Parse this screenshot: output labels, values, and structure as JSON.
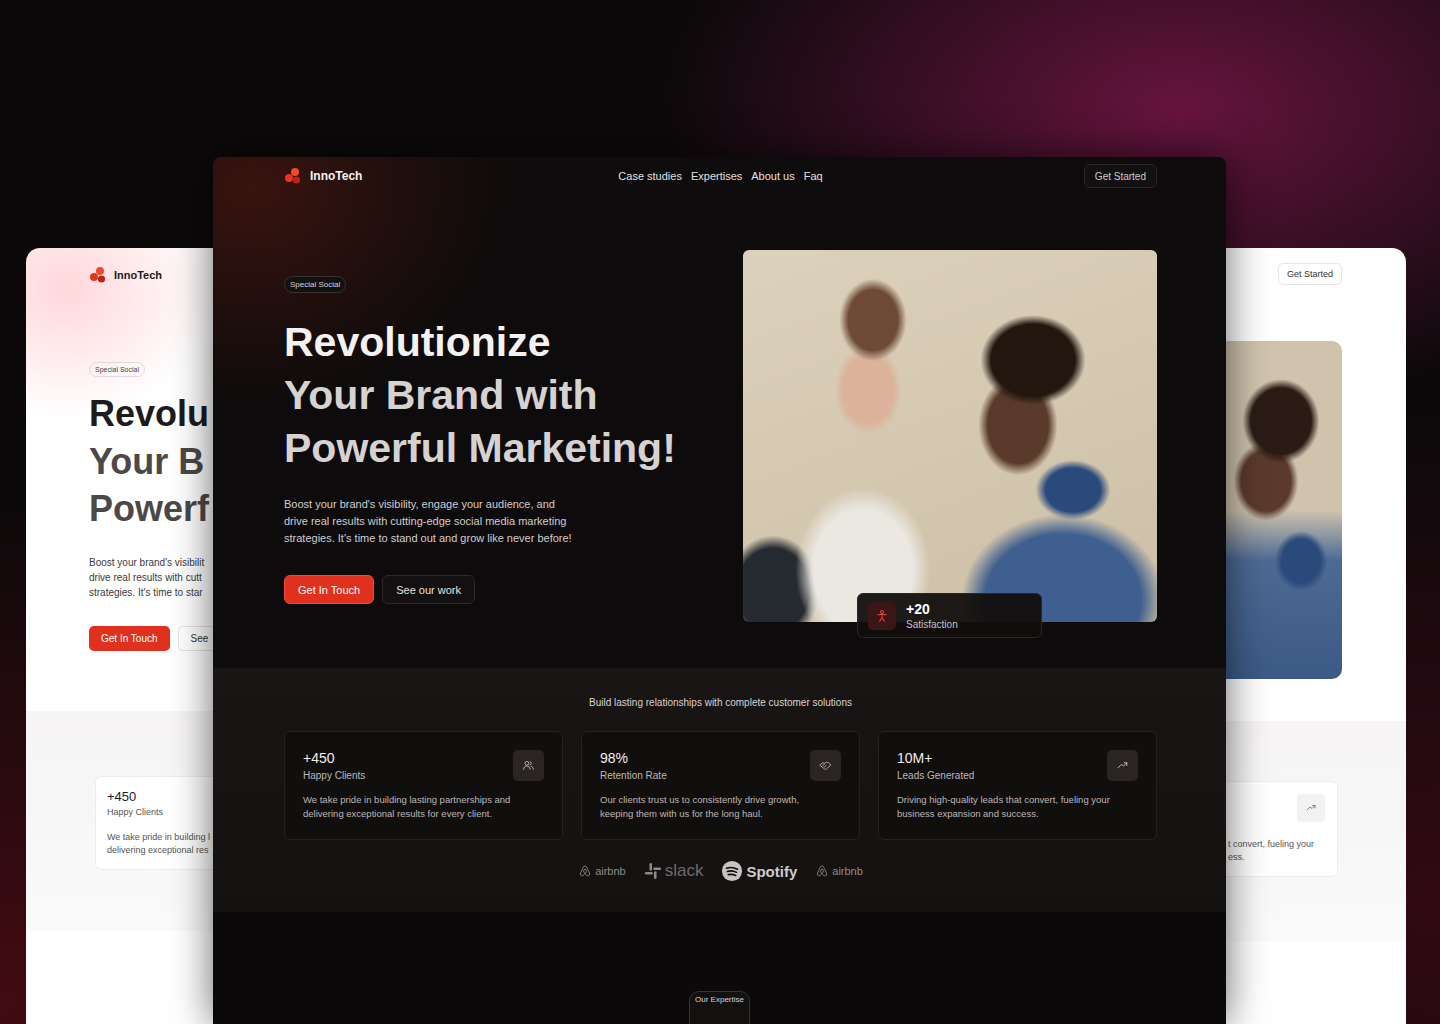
{
  "main": {
    "brand": "InnoTech",
    "nav": [
      {
        "label": "Case studies"
      },
      {
        "label": "Expertises"
      },
      {
        "label": "About us"
      },
      {
        "label": "Faq"
      }
    ],
    "cta": "Get Started",
    "badge": "Special Social",
    "headline": [
      "Revolutionize",
      "Your Brand with",
      "Powerful Marketing!"
    ],
    "body": [
      "Boost your brand's visibility, engage your audience, and",
      "drive real results with cutting-edge social media marketing",
      "strategies. It's time to stand out and grow like never before!"
    ],
    "primary_button": "Get In Touch",
    "secondary_button": "See our work",
    "photo_stat": {
      "value": "+20",
      "label": "Satisfaction"
    },
    "stats_title": "Build lasting relationships with complete customer solutions",
    "stats": [
      {
        "value": "+450",
        "label": "Happy Clients",
        "text": [
          "We take pride in building lasting partnerships and",
          "delivering exceptional results for every client."
        ]
      },
      {
        "value": "98%",
        "label": "Retention Rate",
        "text": [
          "Our clients trust us to consistently drive growth,",
          "keeping them with us for the long haul."
        ]
      },
      {
        "value": "10M+",
        "label": "Leads Generated",
        "text": [
          "Driving high-quality leads that convert, fueling your",
          "business expansion and success."
        ]
      }
    ],
    "partners": [
      {
        "name": "airbnb",
        "kind": "airbnb"
      },
      {
        "name": "slack",
        "kind": "slack"
      },
      {
        "name": "Spotify",
        "kind": "spotify"
      },
      {
        "name": "airbnb",
        "kind": "airbnb"
      }
    ],
    "section_badge": "Our Expertise"
  },
  "left_preview": {
    "brand": "InnoTech",
    "badge": "Special Social",
    "headline": [
      "Revolu",
      "Your B",
      "Powerf"
    ],
    "body": [
      "Boost your brand's visibilit",
      "drive real results with cutt",
      "strategies. It's time to star"
    ],
    "primary_button": "Get In Touch",
    "secondary_button": "See",
    "stat": {
      "value": "+450",
      "label": "Happy Clients",
      "text": [
        "We take pride in building l",
        "delivering exceptional res"
      ]
    }
  },
  "right_preview": {
    "cta": "Get Started",
    "stat_text": [
      "t convert, fueling your",
      "ess."
    ]
  }
}
